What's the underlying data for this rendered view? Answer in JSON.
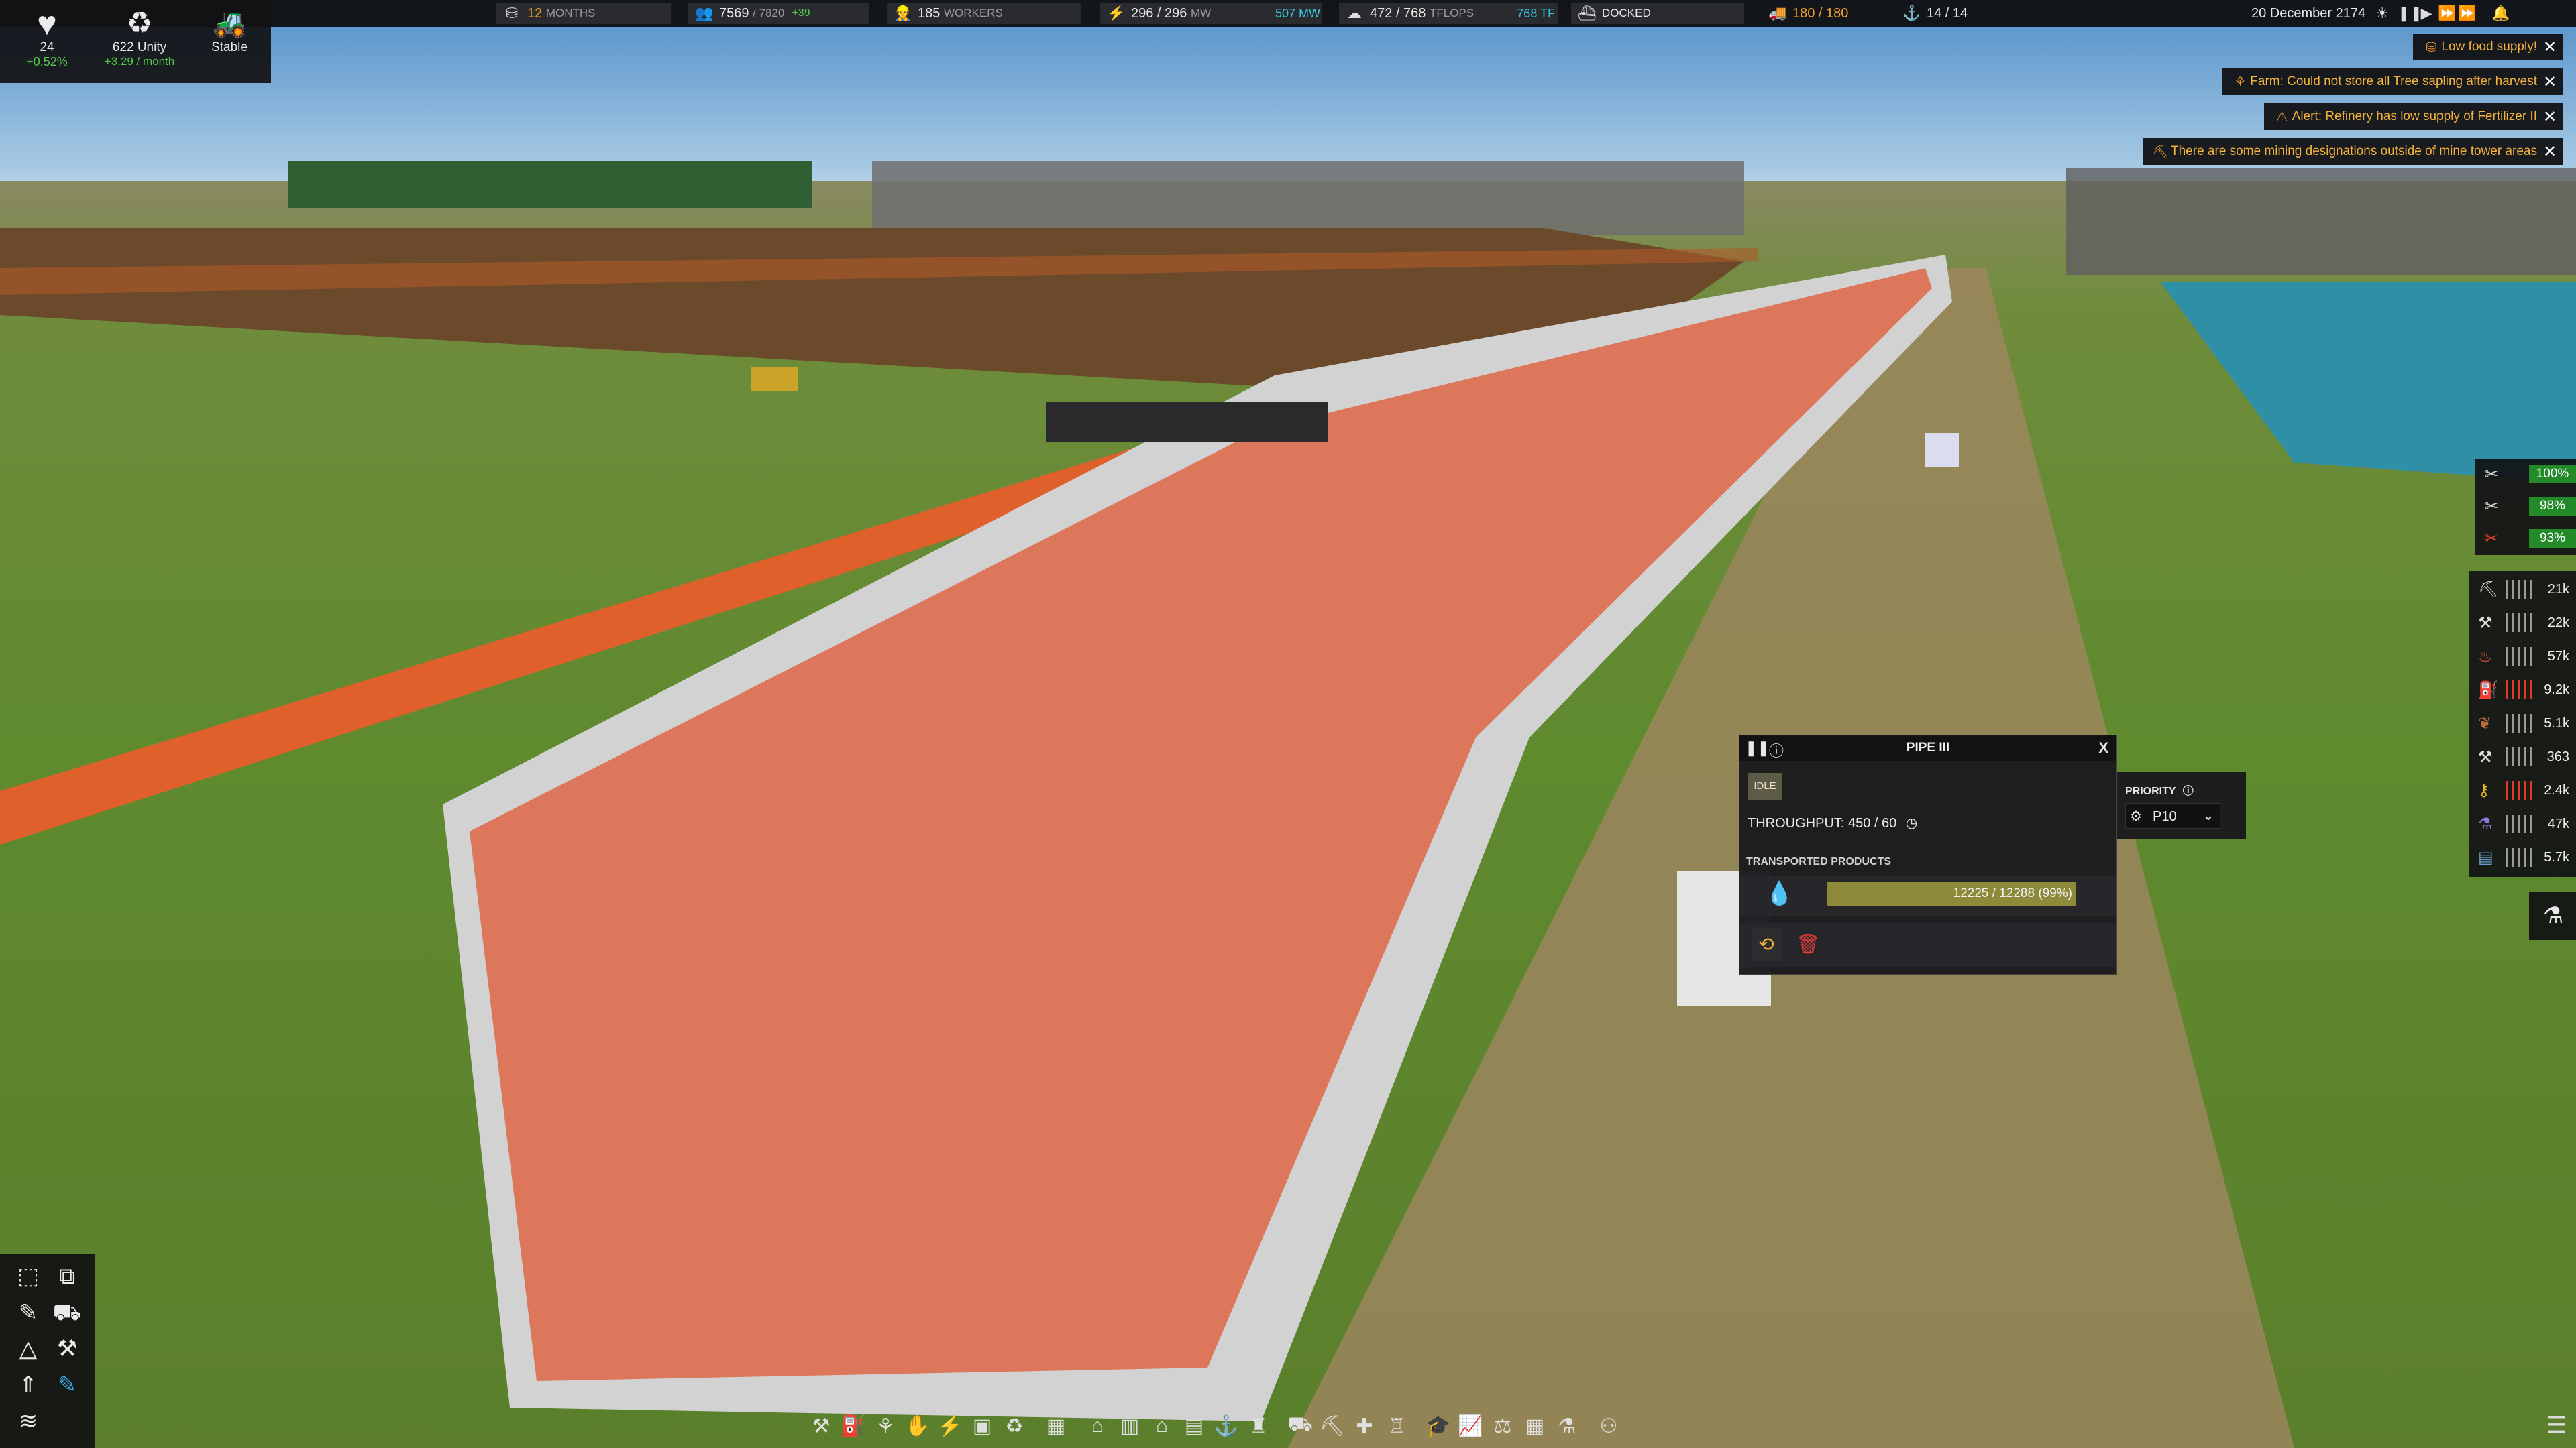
{
  "top_left": {
    "health": {
      "icon": "heart-icon",
      "value": "24",
      "change": "+0.52%"
    },
    "unity": {
      "icon": "unity-icon",
      "value": "622 Unity",
      "rate": "+3.29 / month"
    },
    "status": {
      "icon": "vehicle-icon",
      "value": "Stable"
    }
  },
  "top_bar": {
    "food": {
      "icon": "food-icon",
      "value": "12",
      "label": "MONTHS"
    },
    "population": {
      "icon": "population-icon",
      "value": "7569",
      "max": "/ 7820",
      "change": "+39"
    },
    "workers": {
      "icon": "worker-icon",
      "value": "185",
      "label": "WORKERS"
    },
    "power": {
      "icon": "lightning-icon",
      "value": "296 / 296",
      "unit": "MW",
      "extra": "507 MW"
    },
    "compute": {
      "icon": "cloud-icon",
      "value": "472 / 768",
      "unit": "TFLOPS",
      "extra": "768 TF"
    },
    "ship": {
      "icon": "ship-icon",
      "value": "DOCKED"
    },
    "vehicles": {
      "icon": "truck-icon",
      "value": "180 / 180"
    },
    "unity_boost": {
      "icon": "ship-crew-icon",
      "value": "14 / 14"
    },
    "date": "20 December 2174",
    "notifications_icon": "bell-icon"
  },
  "alerts": [
    {
      "icon": "food-warning-icon",
      "text": "Low food supply!"
    },
    {
      "icon": "farm-icon",
      "text": "Farm: Could not store all Tree sapling after harvest"
    },
    {
      "icon": "worker-alert-icon",
      "text": "Alert: Refinery has low supply of Fertilizer II"
    },
    {
      "icon": "mining-icon",
      "text": "There are some mining designations outside of mine tower areas"
    }
  ],
  "maintenance": [
    {
      "icon": "tools-icon",
      "value": "100%"
    },
    {
      "icon": "wrench-icon",
      "value": "98%"
    },
    {
      "icon": "broken-tools-icon",
      "value": "93%"
    }
  ],
  "resources": [
    {
      "icon": "worker-resource-icon",
      "value": "21k",
      "hot": false
    },
    {
      "icon": "construction-parts-icon",
      "value": "22k",
      "hot": false
    },
    {
      "icon": "food-resource-icon",
      "value": "57k",
      "hot": false
    },
    {
      "icon": "fuel-icon",
      "value": "9.2k",
      "hot": true
    },
    {
      "icon": "meat-icon",
      "value": "5.1k",
      "hot": false
    },
    {
      "icon": "hammer-icon",
      "value": "363",
      "hot": false
    },
    {
      "icon": "gold-key-icon",
      "value": "2.4k",
      "hot": true
    },
    {
      "icon": "chemical-icon",
      "value": "47k",
      "hot": false
    },
    {
      "icon": "electronics-icon",
      "value": "5.7k",
      "hot": false
    }
  ],
  "pipe_window": {
    "title": "PIPE III",
    "status": "IDLE",
    "throughput": "THROUGHPUT: 450 / 60",
    "section_label": "TRANSPORTED PRODUCTS",
    "product_icon": "water-drop-icon",
    "fill_text": "12225 / 12288 (99%)",
    "fill_fraction": 0.99,
    "close": "X"
  },
  "priority": {
    "label": "PRIORITY",
    "value": "P10"
  }
}
